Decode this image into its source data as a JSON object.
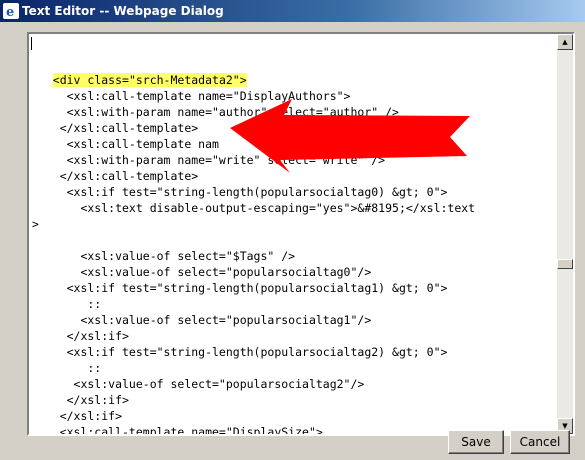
{
  "window": {
    "title": "Text Editor -- Webpage Dialog",
    "icon": "ie-icon"
  },
  "editor": {
    "lines": [
      "",
      "",
      "   <div class=\"srch-Metadata2\">",
      "     <xsl:call-template name=\"DisplayAuthors\">",
      "     <xsl:with-param name=\"author\" select=\"author\" />",
      "    </xsl:call-template>",
      "     <xsl:call-template nam",
      "     <xsl:with-param name=\"write\" select=\"write\" />",
      "    </xsl:call-template>",
      "     <xsl:if test=\"string-length(popularsocialtag0) &gt; 0\">",
      "       <xsl:text disable-output-escaping=\"yes\">&#8195;</xsl:text",
      ">",
      "",
      "       <xsl:value-of select=\"$Tags\" />",
      "       <xsl:value-of select=\"popularsocialtag0\"/>",
      "     <xsl:if test=\"string-length(popularsocialtag1) &gt; 0\">",
      "        ::",
      "       <xsl:value-of select=\"popularsocialtag1\"/>",
      "     </xsl:if>",
      "     <xsl:if test=\"string-length(popularsocialtag2) &gt; 0\">",
      "        ::",
      "      <xsl:value-of select=\"popularsocialtag2\"/>",
      "     </xsl:if>",
      "    </xsl:if>",
      "    <xsl:call-template name=\"DisplaySize\">"
    ],
    "highlight_color": "#ffff66"
  },
  "annotation": {
    "arrow_color": "#ff0000"
  },
  "scrollbar": {
    "up_icon": "scroll-up-arrow-icon",
    "down_icon": "scroll-down-arrow-icon"
  },
  "buttons": {
    "save": "Save",
    "cancel": "Cancel"
  }
}
